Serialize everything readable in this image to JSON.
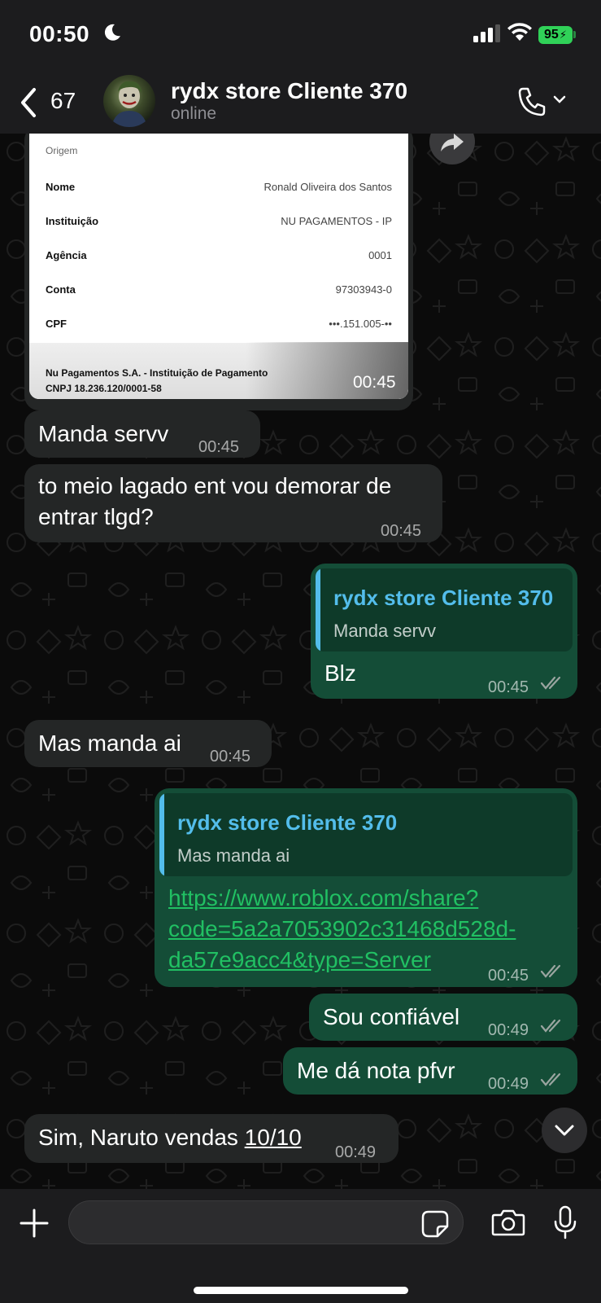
{
  "status_bar": {
    "time": "00:50",
    "battery": "95"
  },
  "header": {
    "back_count": "67",
    "contact_name": "rydx store Cliente 370",
    "status": "online"
  },
  "receipt": {
    "section_label": "Origem",
    "rows": [
      {
        "label": "Nome",
        "value": "Ronald Oliveira dos Santos"
      },
      {
        "label": "Instituição",
        "value": "NU PAGAMENTOS - IP"
      },
      {
        "label": "Agência",
        "value": "0001"
      },
      {
        "label": "Conta",
        "value": "97303943-0"
      },
      {
        "label": "CPF",
        "value": "•••.151.005-••"
      }
    ],
    "footer_line1": "Nu Pagamentos S.A. - Instituição de Pagamento",
    "footer_line2": "CNPJ 18.236.120/0001-58",
    "time": "00:45"
  },
  "messages": [
    {
      "text": "Manda servv",
      "time": "00:45"
    },
    {
      "text_line1": "to meio lagado ent vou demorar de",
      "text_line2": "entrar tlgd?",
      "time": "00:45"
    },
    {
      "quote_name": "rydx store Cliente 370",
      "quote_text": "Manda servv",
      "text": "Blz",
      "time": "00:45"
    },
    {
      "text": "Mas manda ai",
      "time": "00:45"
    },
    {
      "quote_name": "rydx store Cliente 370",
      "quote_text": "Mas manda ai",
      "link_line1": "https://www.roblox.com/share?",
      "link_line2": "code=5a2a7053902c31468d528d-",
      "link_line3": "da57e9acc4&type=Server",
      "time": "00:45"
    },
    {
      "text": "Sou confiável",
      "time": "00:49"
    },
    {
      "text": "Me dá nota pfvr",
      "time": "00:49"
    },
    {
      "text_prefix": "Sim, Naruto vendas ",
      "text_underlined": "10/10",
      "time": "00:49"
    }
  ],
  "input": {
    "placeholder": ""
  },
  "colors": {
    "incoming": "#242626",
    "outgoing": "#144d37",
    "accent_quote": "#53bdeb",
    "link": "#21c063"
  }
}
